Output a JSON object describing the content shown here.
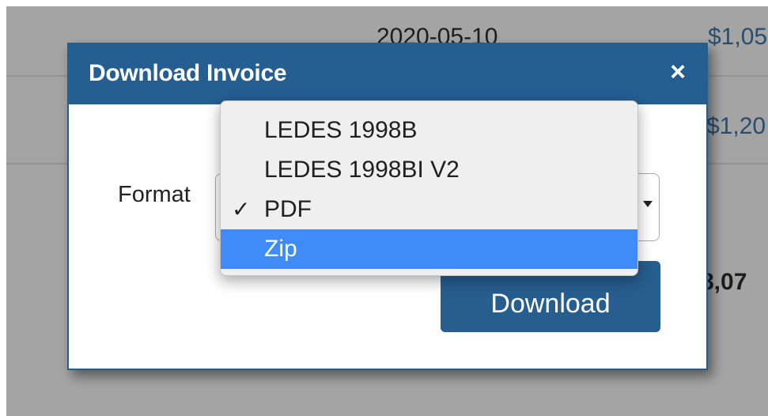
{
  "background": {
    "date": "2020-05-10",
    "amount_1": "$1,05",
    "amount_2": "$1,20",
    "total": "8,07"
  },
  "modal": {
    "title": "Download Invoice",
    "close_glyph": "×",
    "format_label": "Format",
    "download_label": "Download"
  },
  "dropdown": {
    "options": [
      "LEDES 1998B",
      "LEDES 1998BI V2",
      "PDF",
      "Zip"
    ],
    "selected": "PDF",
    "highlighted": "Zip",
    "check_glyph": "✓"
  },
  "colors": {
    "header": "#255e91",
    "button": "#265e90",
    "highlight": "#3f8cf8",
    "backdrop": "#a4a4a4"
  }
}
